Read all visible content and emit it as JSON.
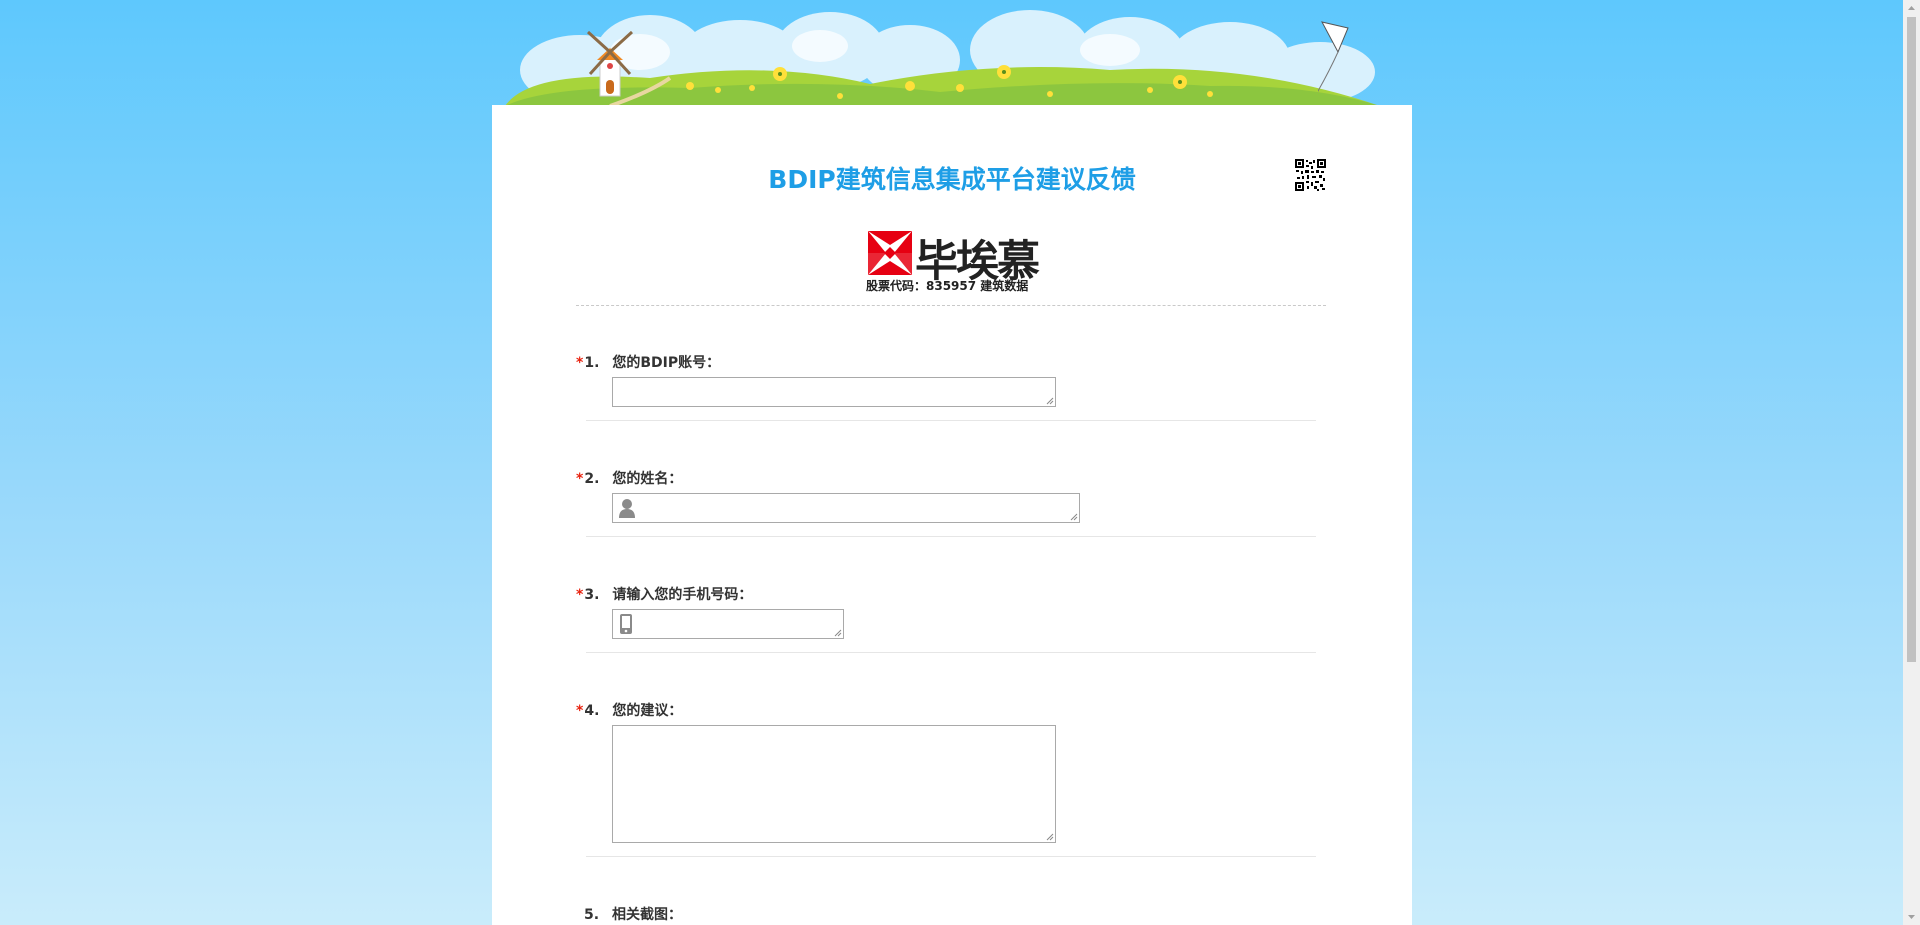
{
  "page": {
    "title": "BDIP建筑信息集成平台建议反馈"
  },
  "logo": {
    "name": "毕埃慕",
    "subtitle": "股票代码：835957 建筑数据"
  },
  "questions": [
    {
      "number": "1.",
      "required": "*",
      "label": "您的BDIP账号：",
      "value": "",
      "icon": null
    },
    {
      "number": "2.",
      "required": "*",
      "label": "您的姓名：",
      "value": "",
      "icon": "user-icon"
    },
    {
      "number": "3.",
      "required": "*",
      "label": "请输入您的手机号码：",
      "value": "",
      "icon": "mobile-phone-icon"
    },
    {
      "number": "4.",
      "required": "*",
      "label": "您的建议：",
      "value": "",
      "icon": null
    },
    {
      "number": "5.",
      "required": "",
      "label": "相关截图：",
      "value": "",
      "icon": null
    }
  ],
  "colors": {
    "title": "#1e9ee6",
    "required": "#e8210e",
    "background_top": "#5ec8fd",
    "logo_red": "#e60012"
  },
  "icons": [
    "windmill-icon",
    "kite-icon",
    "qr-code-icon",
    "user-icon",
    "mobile-phone-icon"
  ]
}
